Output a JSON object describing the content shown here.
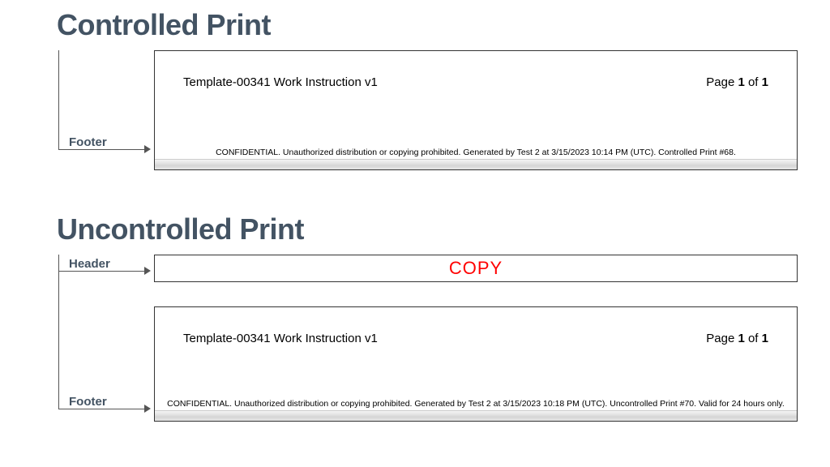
{
  "controlled": {
    "title": "Controlled Print",
    "footer_label": "Footer",
    "doc_title": "Template-00341 Work Instruction v1",
    "page_prefix": "Page ",
    "page_current": "1",
    "page_of": " of ",
    "page_total": "1",
    "confidential": "CONFIDENTIAL. Unauthorized distribution or copying prohibited. Generated by Test 2 at 3/15/2023 10:14 PM (UTC). Controlled Print #68."
  },
  "uncontrolled": {
    "title": "Uncontrolled Print",
    "header_label": "Header",
    "footer_label": "Footer",
    "copy_text": "COPY",
    "doc_title": "Template-00341 Work Instruction v1",
    "page_prefix": "Page ",
    "page_current": "1",
    "page_of": " of ",
    "page_total": "1",
    "confidential": "CONFIDENTIAL. Unauthorized distribution or copying prohibited. Generated by Test 2 at 3/15/2023 10:18 PM (UTC). Uncontrolled Print #70. Valid for 24 hours only."
  }
}
